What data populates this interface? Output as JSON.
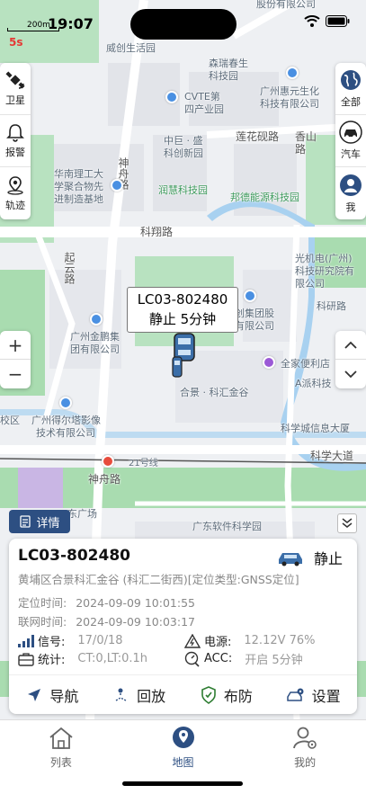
{
  "status_bar": {
    "time": "19:07",
    "scale": "200m",
    "refresh_countdown": "5s"
  },
  "map": {
    "labels": {
      "top_company": "股份有限公司",
      "weichuang": "威创生活园",
      "senrui": "森瑞春生",
      "senrui2": "科技园",
      "huihe1": "广州惠元生化",
      "huihe2": "科技有限公司",
      "cvte1": "CVTE第",
      "cvte2": "四产业园",
      "zhongju1": "中巨 · 盛",
      "zhongju2": "科创新园",
      "lianhua": "莲花砚路",
      "xiangshan1": "香山",
      "xiangshan2": "路",
      "huanan1": "华南理工大",
      "huanan2": "学聚合物先",
      "huanan3": "进制造基地",
      "runhui": "润慧科技园",
      "bangde": "邦德能源科技园",
      "shenzhou_road": "神舟路",
      "kexiang_road": "科翔路",
      "guangji1": "光机电(广州)",
      "guangji2": "科技研究院有",
      "guangji3": "限公司",
      "qiyun": "起云路",
      "kewan": "科研路",
      "weichuang_group1": "威创集团股",
      "weichuang_group2": "份有限公司",
      "jinpeng1": "广州金鹏集",
      "jinpeng2": "团有限公司",
      "quanjia": "全家便利店",
      "ajk": "A派科技",
      "hejing": "合景 · 科汇金谷",
      "deerta1": "广州得尔塔影像",
      "deerta2": "技术有限公司",
      "kexuecheng": "科学城信息大厦",
      "kexue_ave": "科学大道",
      "jiaoqu": "校区",
      "shenzhou2": "神舟路",
      "road21": "21号线",
      "dongguangchang": "东广场",
      "software_park": "广东软件科学园"
    }
  },
  "left_panel": {
    "items": [
      {
        "label": "卫星",
        "icon": "satellite-icon"
      },
      {
        "label": "报警",
        "icon": "bell-icon"
      },
      {
        "label": "轨迹",
        "icon": "location-pin-icon"
      }
    ]
  },
  "right_panel": {
    "items": [
      {
        "label": "全部",
        "icon": "globe-icon"
      },
      {
        "label": "汽车",
        "icon": "car-icon"
      },
      {
        "label": "我",
        "icon": "person-icon"
      }
    ]
  },
  "zoom": {
    "in": "+",
    "out": "−"
  },
  "vehicle_bubble": {
    "plate": "LC03-802480",
    "status": "静止 5分钟"
  },
  "detail_tab": {
    "label": "详情"
  },
  "card": {
    "plate": "LC03-802480",
    "status": "静止",
    "address": "黄埔区合景科汇金谷 (科汇二街西)[定位类型:GNSS定位]",
    "locate_time_label": "定位时间:",
    "locate_time": "2024-09-09 10:01:55",
    "net_time_label": "联网时间:",
    "net_time": "2024-09-09 10:03:17",
    "signal_label": "信号:",
    "signal_value": "17/0/18",
    "power_label": "电源:",
    "power_value": "12.12V 76%",
    "stats_label": "统计:",
    "stats_value": "CT:0,LT:0.1h",
    "acc_label": "ACC:",
    "acc_value": "开启 5分钟",
    "actions": [
      {
        "label": "导航",
        "icon": "navigation-arrow-icon"
      },
      {
        "label": "回放",
        "icon": "route-icon"
      },
      {
        "label": "布防",
        "icon": "shield-icon"
      },
      {
        "label": "设置",
        "icon": "car-settings-icon"
      }
    ]
  },
  "tabbar": {
    "items": [
      {
        "label": "列表",
        "icon": "home-icon",
        "active": false
      },
      {
        "label": "地图",
        "icon": "map-pin-icon",
        "active": true
      },
      {
        "label": "我的",
        "icon": "user-settings-icon",
        "active": false
      }
    ]
  },
  "colors": {
    "accent": "#2d4f82",
    "alert": "#e53935",
    "map_green": "#a9dcb0",
    "water": "#a8d1f0"
  }
}
